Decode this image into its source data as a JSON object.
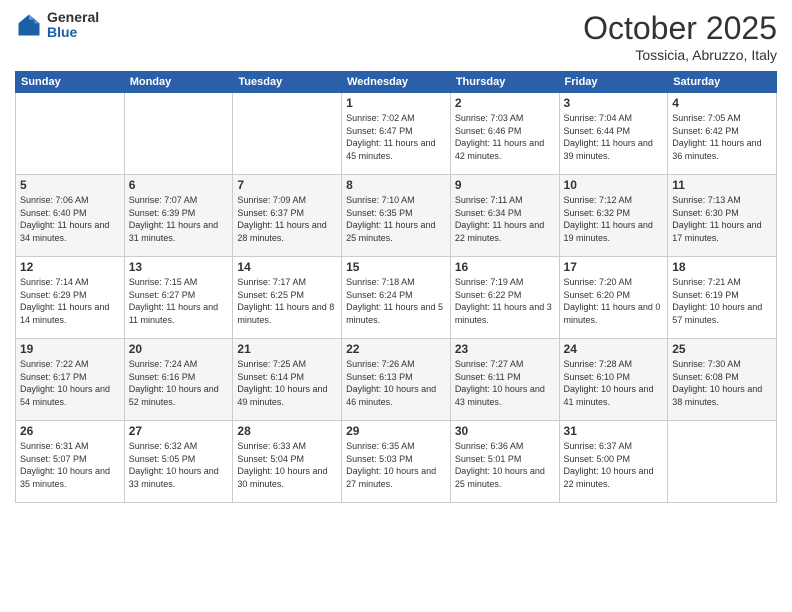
{
  "header": {
    "logo_general": "General",
    "logo_blue": "Blue",
    "month_title": "October 2025",
    "subtitle": "Tossicia, Abruzzo, Italy"
  },
  "weekdays": [
    "Sunday",
    "Monday",
    "Tuesday",
    "Wednesday",
    "Thursday",
    "Friday",
    "Saturday"
  ],
  "weeks": [
    [
      {
        "day": "",
        "sunrise": "",
        "sunset": "",
        "daylight": ""
      },
      {
        "day": "",
        "sunrise": "",
        "sunset": "",
        "daylight": ""
      },
      {
        "day": "",
        "sunrise": "",
        "sunset": "",
        "daylight": ""
      },
      {
        "day": "1",
        "sunrise": "Sunrise: 7:02 AM",
        "sunset": "Sunset: 6:47 PM",
        "daylight": "Daylight: 11 hours and 45 minutes."
      },
      {
        "day": "2",
        "sunrise": "Sunrise: 7:03 AM",
        "sunset": "Sunset: 6:46 PM",
        "daylight": "Daylight: 11 hours and 42 minutes."
      },
      {
        "day": "3",
        "sunrise": "Sunrise: 7:04 AM",
        "sunset": "Sunset: 6:44 PM",
        "daylight": "Daylight: 11 hours and 39 minutes."
      },
      {
        "day": "4",
        "sunrise": "Sunrise: 7:05 AM",
        "sunset": "Sunset: 6:42 PM",
        "daylight": "Daylight: 11 hours and 36 minutes."
      }
    ],
    [
      {
        "day": "5",
        "sunrise": "Sunrise: 7:06 AM",
        "sunset": "Sunset: 6:40 PM",
        "daylight": "Daylight: 11 hours and 34 minutes."
      },
      {
        "day": "6",
        "sunrise": "Sunrise: 7:07 AM",
        "sunset": "Sunset: 6:39 PM",
        "daylight": "Daylight: 11 hours and 31 minutes."
      },
      {
        "day": "7",
        "sunrise": "Sunrise: 7:09 AM",
        "sunset": "Sunset: 6:37 PM",
        "daylight": "Daylight: 11 hours and 28 minutes."
      },
      {
        "day": "8",
        "sunrise": "Sunrise: 7:10 AM",
        "sunset": "Sunset: 6:35 PM",
        "daylight": "Daylight: 11 hours and 25 minutes."
      },
      {
        "day": "9",
        "sunrise": "Sunrise: 7:11 AM",
        "sunset": "Sunset: 6:34 PM",
        "daylight": "Daylight: 11 hours and 22 minutes."
      },
      {
        "day": "10",
        "sunrise": "Sunrise: 7:12 AM",
        "sunset": "Sunset: 6:32 PM",
        "daylight": "Daylight: 11 hours and 19 minutes."
      },
      {
        "day": "11",
        "sunrise": "Sunrise: 7:13 AM",
        "sunset": "Sunset: 6:30 PM",
        "daylight": "Daylight: 11 hours and 17 minutes."
      }
    ],
    [
      {
        "day": "12",
        "sunrise": "Sunrise: 7:14 AM",
        "sunset": "Sunset: 6:29 PM",
        "daylight": "Daylight: 11 hours and 14 minutes."
      },
      {
        "day": "13",
        "sunrise": "Sunrise: 7:15 AM",
        "sunset": "Sunset: 6:27 PM",
        "daylight": "Daylight: 11 hours and 11 minutes."
      },
      {
        "day": "14",
        "sunrise": "Sunrise: 7:17 AM",
        "sunset": "Sunset: 6:25 PM",
        "daylight": "Daylight: 11 hours and 8 minutes."
      },
      {
        "day": "15",
        "sunrise": "Sunrise: 7:18 AM",
        "sunset": "Sunset: 6:24 PM",
        "daylight": "Daylight: 11 hours and 5 minutes."
      },
      {
        "day": "16",
        "sunrise": "Sunrise: 7:19 AM",
        "sunset": "Sunset: 6:22 PM",
        "daylight": "Daylight: 11 hours and 3 minutes."
      },
      {
        "day": "17",
        "sunrise": "Sunrise: 7:20 AM",
        "sunset": "Sunset: 6:20 PM",
        "daylight": "Daylight: 11 hours and 0 minutes."
      },
      {
        "day": "18",
        "sunrise": "Sunrise: 7:21 AM",
        "sunset": "Sunset: 6:19 PM",
        "daylight": "Daylight: 10 hours and 57 minutes."
      }
    ],
    [
      {
        "day": "19",
        "sunrise": "Sunrise: 7:22 AM",
        "sunset": "Sunset: 6:17 PM",
        "daylight": "Daylight: 10 hours and 54 minutes."
      },
      {
        "day": "20",
        "sunrise": "Sunrise: 7:24 AM",
        "sunset": "Sunset: 6:16 PM",
        "daylight": "Daylight: 10 hours and 52 minutes."
      },
      {
        "day": "21",
        "sunrise": "Sunrise: 7:25 AM",
        "sunset": "Sunset: 6:14 PM",
        "daylight": "Daylight: 10 hours and 49 minutes."
      },
      {
        "day": "22",
        "sunrise": "Sunrise: 7:26 AM",
        "sunset": "Sunset: 6:13 PM",
        "daylight": "Daylight: 10 hours and 46 minutes."
      },
      {
        "day": "23",
        "sunrise": "Sunrise: 7:27 AM",
        "sunset": "Sunset: 6:11 PM",
        "daylight": "Daylight: 10 hours and 43 minutes."
      },
      {
        "day": "24",
        "sunrise": "Sunrise: 7:28 AM",
        "sunset": "Sunset: 6:10 PM",
        "daylight": "Daylight: 10 hours and 41 minutes."
      },
      {
        "day": "25",
        "sunrise": "Sunrise: 7:30 AM",
        "sunset": "Sunset: 6:08 PM",
        "daylight": "Daylight: 10 hours and 38 minutes."
      }
    ],
    [
      {
        "day": "26",
        "sunrise": "Sunrise: 6:31 AM",
        "sunset": "Sunset: 5:07 PM",
        "daylight": "Daylight: 10 hours and 35 minutes."
      },
      {
        "day": "27",
        "sunrise": "Sunrise: 6:32 AM",
        "sunset": "Sunset: 5:05 PM",
        "daylight": "Daylight: 10 hours and 33 minutes."
      },
      {
        "day": "28",
        "sunrise": "Sunrise: 6:33 AM",
        "sunset": "Sunset: 5:04 PM",
        "daylight": "Daylight: 10 hours and 30 minutes."
      },
      {
        "day": "29",
        "sunrise": "Sunrise: 6:35 AM",
        "sunset": "Sunset: 5:03 PM",
        "daylight": "Daylight: 10 hours and 27 minutes."
      },
      {
        "day": "30",
        "sunrise": "Sunrise: 6:36 AM",
        "sunset": "Sunset: 5:01 PM",
        "daylight": "Daylight: 10 hours and 25 minutes."
      },
      {
        "day": "31",
        "sunrise": "Sunrise: 6:37 AM",
        "sunset": "Sunset: 5:00 PM",
        "daylight": "Daylight: 10 hours and 22 minutes."
      },
      {
        "day": "",
        "sunrise": "",
        "sunset": "",
        "daylight": ""
      }
    ]
  ]
}
